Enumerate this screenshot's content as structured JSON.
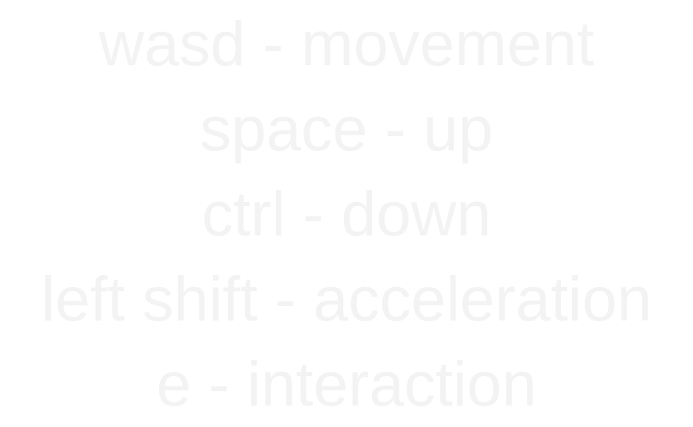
{
  "controls": {
    "lines": [
      "wasd - movement",
      "space - up",
      "ctrl - down",
      "left shift - acceleration",
      "e - interaction"
    ]
  },
  "colors": {
    "background": "#ffffff",
    "text": "#f3f3f3"
  }
}
